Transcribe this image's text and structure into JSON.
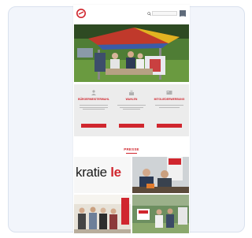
{
  "colors": {
    "brand_red": "#d0262e",
    "background": "#f2f5fb",
    "info_bg": "#ececec"
  },
  "header": {
    "logo_icon": "party-logo-icon",
    "logo_text": "",
    "search_icon": "search-icon",
    "search_placeholder": "",
    "menu_icon": "hamburger-menu-icon"
  },
  "info_section": {
    "columns": [
      {
        "icon": "person-icon",
        "title": "BÜRGERMEISTERWAHL"
      },
      {
        "icon": "ballot-icon",
        "title": "WAHLEN"
      },
      {
        "icon": "people-icon",
        "title": "MITGLIEDERWERBUNG"
      }
    ]
  },
  "press": {
    "title": "PRESSE",
    "tiles": [
      {
        "text_main": "kratie",
        "text_accent": "le"
      }
    ]
  }
}
